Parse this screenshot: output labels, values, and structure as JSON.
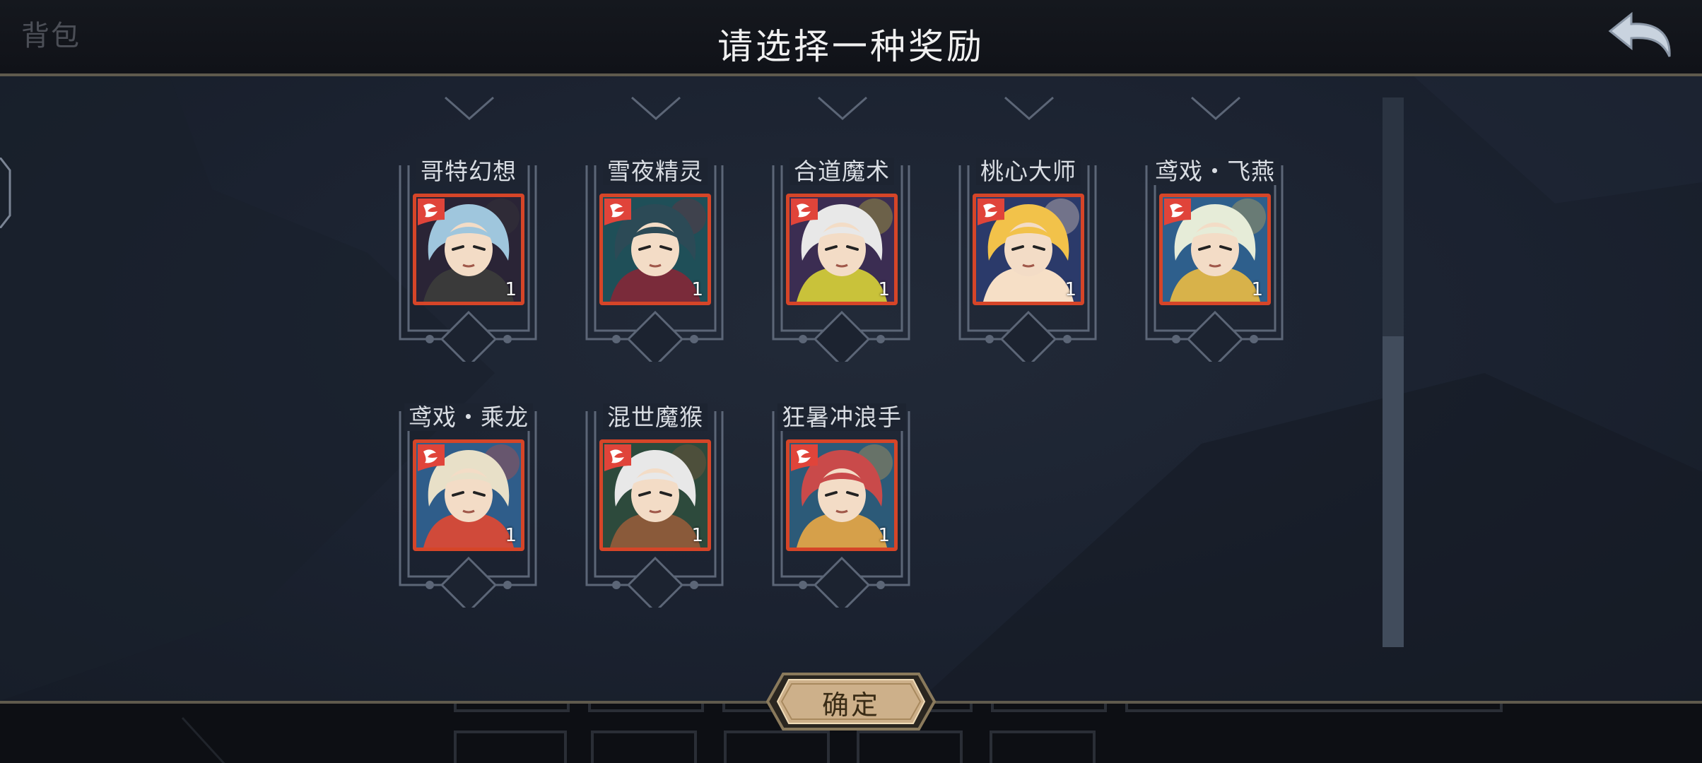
{
  "header": {
    "bag_label": "背包",
    "title": "请选择一种奖励",
    "back_icon": "back-arrow-icon"
  },
  "rewards": [
    {
      "name": "哥特幻想",
      "count": "1",
      "colors": {
        "hair": "#9fc6dd",
        "bg": "#2a2436",
        "accent": "#3a3a3a"
      }
    },
    {
      "name": "雪夜精灵",
      "count": "1",
      "colors": {
        "hair": "#2c4a56",
        "bg": "#1f4f58",
        "accent": "#7a2b3a"
      }
    },
    {
      "name": "合道魔术",
      "count": "1",
      "colors": {
        "hair": "#e8e8e8",
        "bg": "#3b2d52",
        "accent": "#c9c23a"
      }
    },
    {
      "name": "桃心大师",
      "count": "1",
      "colors": {
        "hair": "#f2c24a",
        "bg": "#2b3a6a",
        "accent": "#f6dfc6"
      }
    },
    {
      "name": "鸢戏・飞燕",
      "count": "1",
      "colors": {
        "hair": "#e6ecd8",
        "bg": "#2e5f8c",
        "accent": "#d8b24a"
      }
    },
    {
      "name": "鸢戏・乘龙",
      "count": "1",
      "colors": {
        "hair": "#e8e0c8",
        "bg": "#2f5d8a",
        "accent": "#d04a3a"
      }
    },
    {
      "name": "混世魔猴",
      "count": "1",
      "colors": {
        "hair": "#e8e8e8",
        "bg": "#2d4a3c",
        "accent": "#8a5a3a"
      }
    },
    {
      "name": "狂暑冲浪手",
      "count": "1",
      "colors": {
        "hair": "#c94a4a",
        "bg": "#2c5a78",
        "accent": "#d6a04a"
      }
    }
  ],
  "footer": {
    "confirm_label": "确定"
  },
  "theme": {
    "frame_color": "#5c6677",
    "portrait_border": "#d64528",
    "badge_color": "#e0443a",
    "button_fill": "#cdb08a"
  }
}
